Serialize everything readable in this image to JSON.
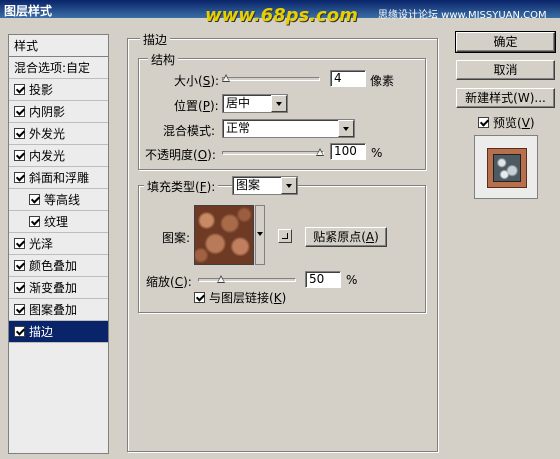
{
  "window": {
    "title": "图层样式"
  },
  "watermark": {
    "main": "www.68ps.com",
    "side": "思缘设计论坛 www.MISSYUAN.COM"
  },
  "sidebar": {
    "head": "样式",
    "blend": "混合选项:自定",
    "items": [
      {
        "label": "投影",
        "checked": true
      },
      {
        "label": "内阴影",
        "checked": true
      },
      {
        "label": "外发光",
        "checked": true
      },
      {
        "label": "内发光",
        "checked": true
      },
      {
        "label": "斜面和浮雕",
        "checked": true
      },
      {
        "label": "等高线",
        "checked": true
      },
      {
        "label": "纹理",
        "checked": true
      },
      {
        "label": "光泽",
        "checked": true
      },
      {
        "label": "颜色叠加",
        "checked": true
      },
      {
        "label": "渐变叠加",
        "checked": true
      },
      {
        "label": "图案叠加",
        "checked": true
      },
      {
        "label": "描边",
        "checked": true,
        "selected": true
      }
    ]
  },
  "stroke": {
    "title": "描边",
    "structure": {
      "title": "结构",
      "size_label": "大小(",
      "size_key": "S",
      "size_end": "):",
      "size_value": "4",
      "size_unit": "像素",
      "position_label": "位置(",
      "position_key": "P",
      "position_end": "):",
      "position_value": "居中",
      "blend_label": "混合模式:",
      "blend_value": "正常",
      "opacity_label": "不透明度(",
      "opacity_key": "O",
      "opacity_end": "):",
      "opacity_value": "100",
      "opacity_unit": "%"
    },
    "fill": {
      "type_label": "填充类型(",
      "type_key": "F",
      "type_end": "):",
      "type_value": "图案",
      "pattern_label": "图案:",
      "snap_button": "贴紧原点(",
      "snap_key": "A",
      "snap_end": ")",
      "scale_label": "缩放(",
      "scale_key": "C",
      "scale_end": "):",
      "scale_value": "50",
      "scale_unit": "%",
      "link_label": "与图层链接(",
      "link_key": "K",
      "link_end": ")",
      "link_checked": true
    }
  },
  "buttons": {
    "ok": "确定",
    "cancel": "取消",
    "new_style": "新建样式(W)...",
    "preview_label": "预览(",
    "preview_key": "V",
    "preview_end": ")",
    "preview_checked": true
  }
}
